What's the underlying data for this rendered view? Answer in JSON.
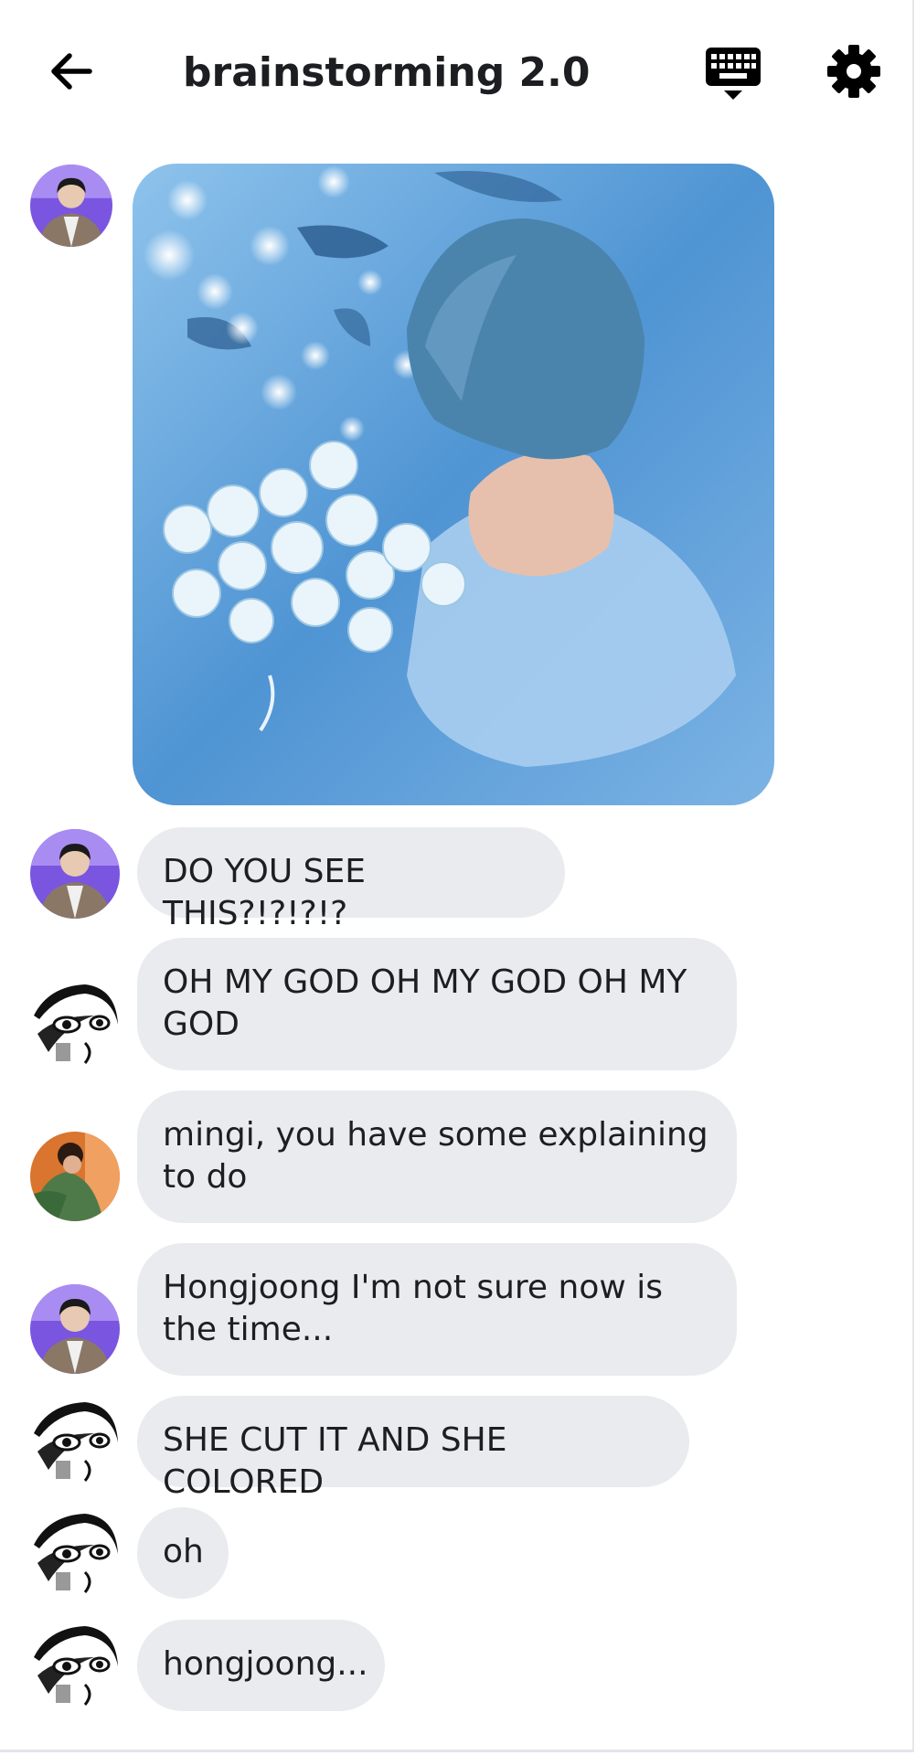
{
  "header": {
    "title": "brainstorming 2.0",
    "back_icon": "arrow-left-icon",
    "keyboard_icon": "keyboard-icon",
    "settings_icon": "gear-icon"
  },
  "messages": [
    {
      "type": "image",
      "avatar": "avatar-purple-suit",
      "image": "photo-girl-in-water-with-roses"
    },
    {
      "type": "text",
      "avatar": "avatar-purple-suit",
      "text": "DO YOU SEE THIS?!?!?!?"
    },
    {
      "type": "text",
      "avatar": "avatar-manga",
      "text": "OH MY GOD OH MY GOD OH MY GOD"
    },
    {
      "type": "text",
      "avatar": "avatar-orange-green",
      "text": "mingi, you have some explaining to do"
    },
    {
      "type": "text",
      "avatar": "avatar-purple-suit",
      "text": "Hongjoong I'm not sure now is the time..."
    },
    {
      "type": "text",
      "avatar": "avatar-manga",
      "text": "SHE CUT IT AND SHE COLORED"
    },
    {
      "type": "text",
      "avatar": "avatar-manga",
      "text": "oh"
    },
    {
      "type": "text",
      "avatar": "avatar-manga",
      "text": "hongjoong..."
    }
  ],
  "colors": {
    "bubble": "#e9ebee",
    "text": "#1c1e21",
    "avatar_purple": "#7a55e0",
    "water": "#5aa0d8"
  }
}
